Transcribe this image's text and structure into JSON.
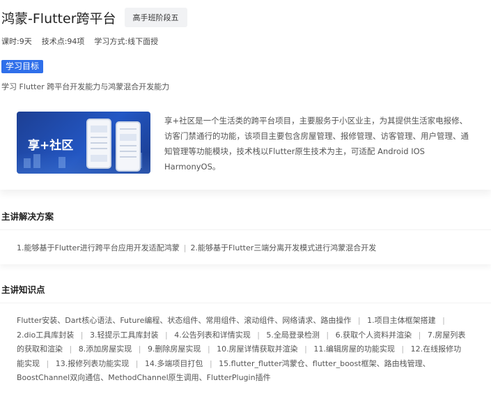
{
  "header": {
    "title": "鸿蒙-Flutter跨平台",
    "stage_badge": "高手班阶段五"
  },
  "meta": {
    "hours": "课时:9天",
    "points": "技术点:94项",
    "mode": "学习方式:线下面授"
  },
  "goal": {
    "tag": "学习目标",
    "text": "学习 Flutter 跨平台开发能力与鸿蒙混合开发能力"
  },
  "project": {
    "banner_text": "享+社区",
    "intro": "享+社区是一个生活类的跨平台项目，主要服务于小区业主，为其提供生活家电报修、访客门禁通行的功能，该项目主要包含房屋管理、报修管理、访客管理、用户管理、通知管理等功能模块，技术栈以Flutter原生技术为主，可适配 Android IOS HarmonyOS。"
  },
  "solutions": {
    "title": "主讲解决方案",
    "items": [
      "1.能够基于Flutter进行跨平台应用开发适配鸿蒙",
      "2.能够基于Flutter三端分离开发模式进行鸿蒙混合开发"
    ]
  },
  "knowledge": {
    "title": "主讲知识点",
    "items": [
      "Flutter安装、Dart核心语法、Future编程、状态组件、常用组件、滚动组件、网络请求、路由操作",
      "1.项目主体框架搭建",
      "2.dio工具库封装",
      "3.轻提示工具库封装",
      "4.公告列表和详情实现",
      "5.全局登录检测",
      "6.获取个人资料并渲染",
      "7.房屋列表的获取和渲染",
      "8.添加房屋实现",
      "9.删除房屋实现",
      "10.房屋详情获取并渲染",
      "11.编辑房屋的功能实现",
      "12.在线报修功能实现",
      "13.报修列表功能实现",
      "14.多端项目打包",
      "15.flutter_flutter鸿蒙仓、flutter_boost框架、路由栈管理、BoostChannel双向通信、MethodChannel原生调用、FlutterPlugin插件"
    ],
    "separator": "|"
  },
  "colors": {
    "accent": "#2f6fea",
    "banner": "#2357c4"
  }
}
